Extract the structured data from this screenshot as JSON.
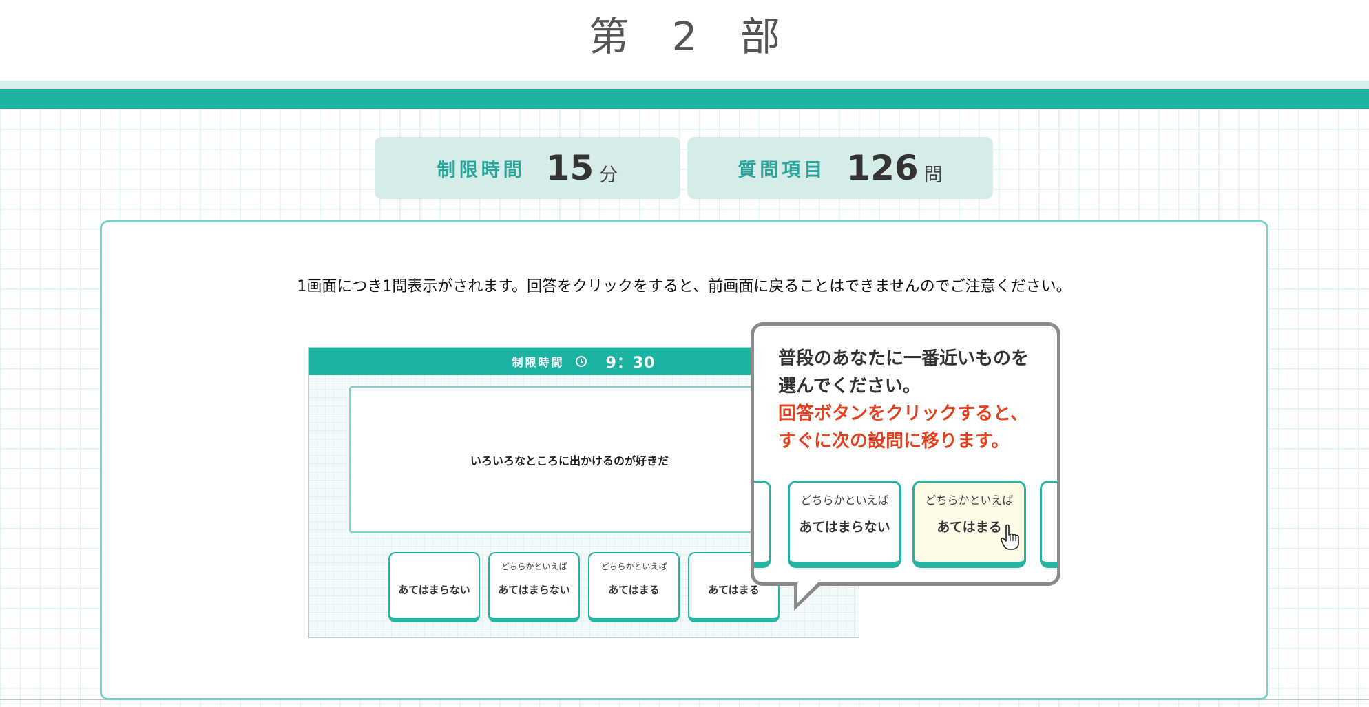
{
  "header": {
    "title": "第 2 部"
  },
  "info": {
    "time_label": "制限時間",
    "time_value": "15",
    "time_unit": "分",
    "count_label": "質問項目",
    "count_value": "126",
    "count_unit": "問"
  },
  "notice": "1画面につき1問表示がされます。回答をクリックをすると、前画面に戻ることはできませんのでご注意ください。",
  "preview": {
    "header_label": "制限時間",
    "header_time": "9：30",
    "question": "いろいろなところに出かけるのが好きだ",
    "answers": [
      {
        "sub": "",
        "main": "あてはまらない"
      },
      {
        "sub": "どちらかといえば",
        "main": "あてはまらない"
      },
      {
        "sub": "どちらかといえば",
        "main": "あてはまる"
      },
      {
        "sub": "",
        "main": "あてはまる"
      }
    ]
  },
  "callout": {
    "line1": "普段のあなたに一番近いものを",
    "line2": "選んでください。",
    "line3": "回答ボタンをクリックすると、",
    "line4": "すぐに次の設問に移ります。",
    "answers": [
      {
        "sub": "どちらかといえば",
        "main": "あてはまらない"
      },
      {
        "sub": "どちらかといえば",
        "main": "あてはまる"
      }
    ]
  },
  "colors": {
    "accent": "#1db3a2",
    "info_bg": "#d5ece9",
    "highlight_text": "#e2401f"
  },
  "icons": {
    "clock": "clock-icon",
    "cursor": "hand-pointer-icon"
  }
}
